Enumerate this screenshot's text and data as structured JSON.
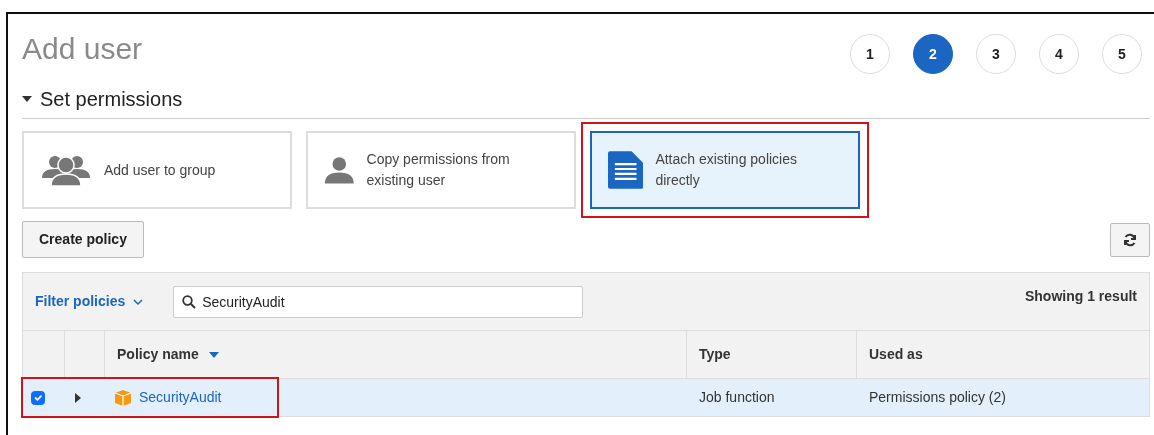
{
  "title": "Add user",
  "steps": [
    {
      "label": "1",
      "selected": false
    },
    {
      "label": "2",
      "selected": true
    },
    {
      "label": "3",
      "selected": false
    },
    {
      "label": "4",
      "selected": false
    },
    {
      "label": "5",
      "selected": false
    }
  ],
  "section": {
    "title": "Set permissions",
    "expanded": true
  },
  "options": [
    {
      "kind": "group",
      "label": "Add user to group",
      "selected": false,
      "highlighted": false
    },
    {
      "kind": "user",
      "label": "Copy permissions from existing user",
      "selected": false,
      "highlighted": false
    },
    {
      "kind": "document",
      "label": "Attach existing policies directly",
      "selected": true,
      "highlighted": true
    }
  ],
  "create_button": "Create policy",
  "filter": {
    "label": "Filter policies",
    "search": "SecurityAudit",
    "result_count": "Showing 1 result"
  },
  "columns": [
    {
      "label": "Policy name",
      "sorted": true
    },
    {
      "label": "Type",
      "sorted": false
    },
    {
      "label": "Used as",
      "sorted": false
    }
  ],
  "rows": [
    {
      "checked": true,
      "expanded": false,
      "highlighted": true,
      "name": "SecurityAudit",
      "type": "Job function",
      "used_as": "Permissions policy (2)"
    }
  ]
}
